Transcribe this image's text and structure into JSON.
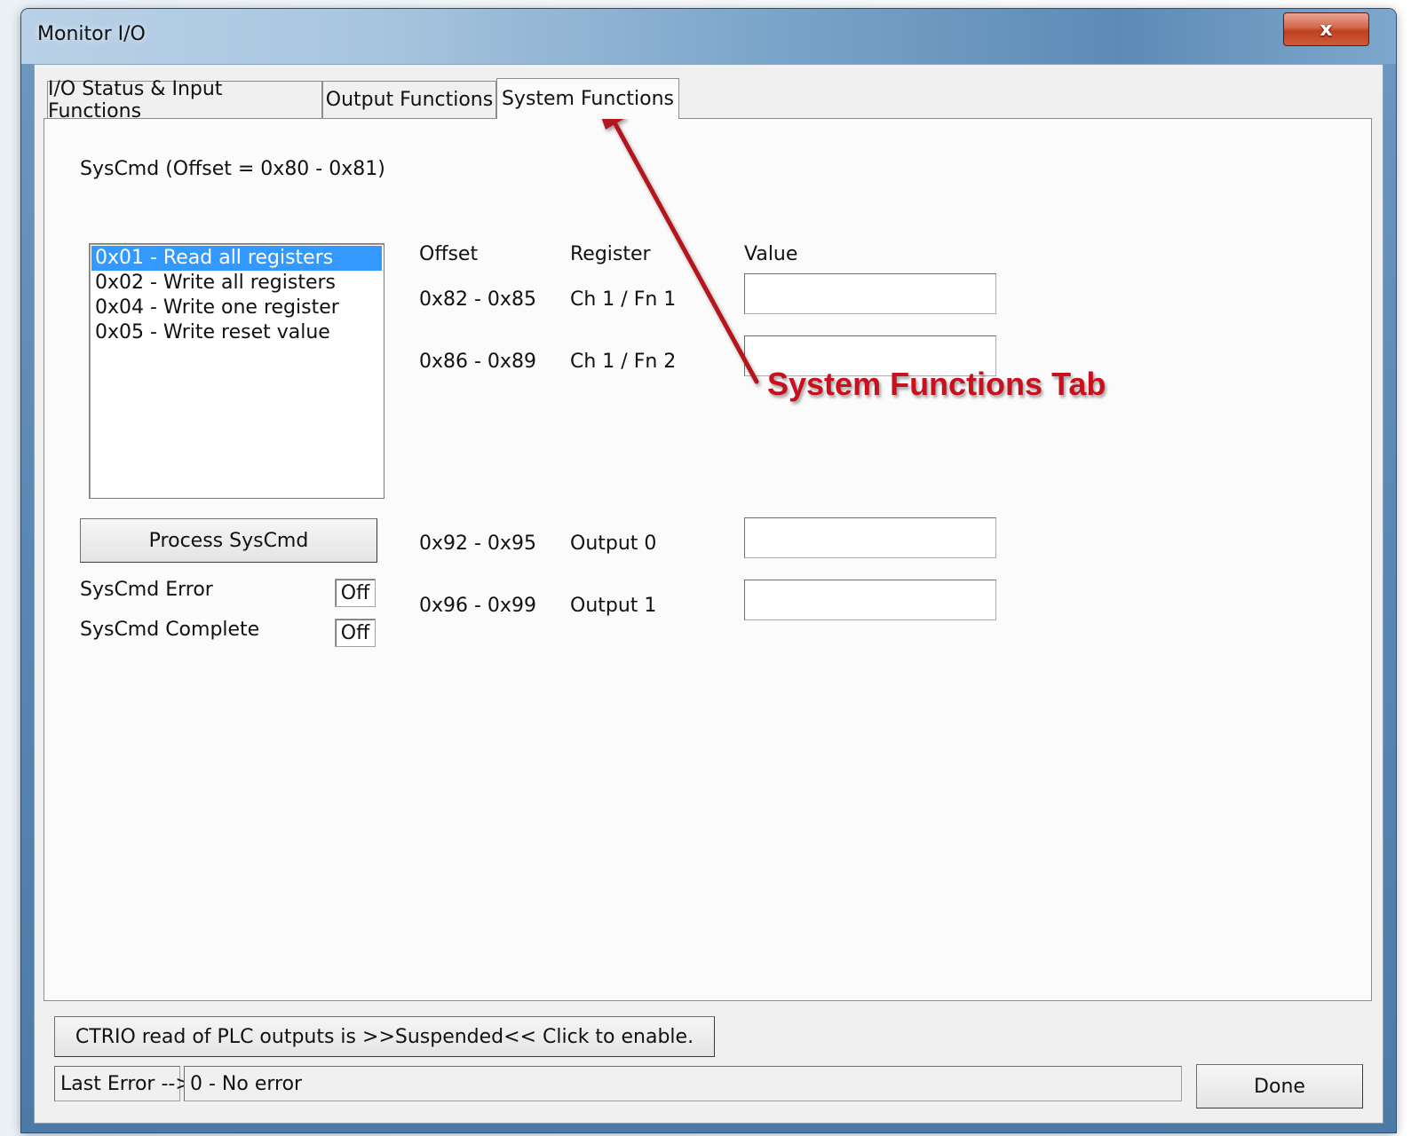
{
  "window": {
    "title": "Monitor I/O",
    "close_label": "x"
  },
  "tabs": [
    {
      "label": "I/O Status & Input Functions",
      "active": false
    },
    {
      "label": "Output Functions",
      "active": false
    },
    {
      "label": "System Functions",
      "active": true
    }
  ],
  "syscmd": {
    "group_label": "SysCmd (Offset = 0x80 - 0x81)",
    "items": [
      "0x01 - Read all registers",
      "0x02 - Write all registers",
      "0x04 - Write one register",
      "0x05 - Write reset value"
    ],
    "selected_index": 0,
    "process_button": "Process SysCmd",
    "error_label": "SysCmd Error",
    "error_value": "Off",
    "complete_label": "SysCmd Complete",
    "complete_value": "Off"
  },
  "registers": {
    "headers": {
      "offset": "Offset",
      "register": "Register",
      "value": "Value"
    },
    "rows": [
      {
        "offset": "0x82 - 0x85",
        "register": "Ch 1 / Fn 1",
        "value": ""
      },
      {
        "offset": "0x86 - 0x89",
        "register": "Ch 1 / Fn 2",
        "value": ""
      },
      {
        "offset": "0x92 - 0x95",
        "register": "Output 0",
        "value": ""
      },
      {
        "offset": "0x96 - 0x99",
        "register": "Output 1",
        "value": ""
      }
    ]
  },
  "annotation": {
    "text": "System Functions Tab",
    "color": "#c8101e"
  },
  "footer": {
    "ctrio_button": "CTRIO read of PLC outputs is >>Suspended<< Click to enable.",
    "last_error_label": "Last Error -->",
    "last_error_value": "0 - No error",
    "done_button": "Done"
  }
}
